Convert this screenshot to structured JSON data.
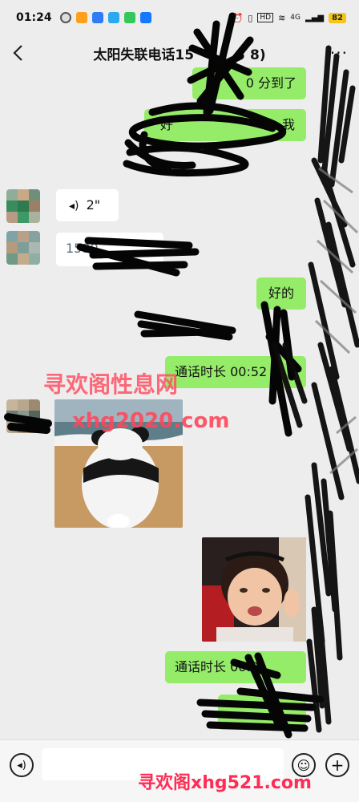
{
  "status_bar": {
    "time": "01:24",
    "network_label": "HD",
    "signal_label": "4G",
    "battery": "82"
  },
  "header": {
    "title": "太阳失联电话15",
    "title_suffix": "8)",
    "more_label": "···"
  },
  "messages": {
    "m1_text": "0 分到了",
    "m2_text": "好",
    "m2_tail": "我",
    "m3_voice_duration": "2\"",
    "m4_text": "1590",
    "m5_text": "好的",
    "m6_call": "通话时长 00:52",
    "m9_call": "通话时长 00:0"
  },
  "watermarks": {
    "top_line1": "寻欢阁性息网",
    "top_line2": "xhg2020.com",
    "bottom": "寻欢阁xhg521.com"
  },
  "colors": {
    "outgoing_bubble": "#95ec69",
    "incoming_bubble": "#ffffff",
    "background": "#ededed",
    "watermark_red": "#ff3b55"
  }
}
